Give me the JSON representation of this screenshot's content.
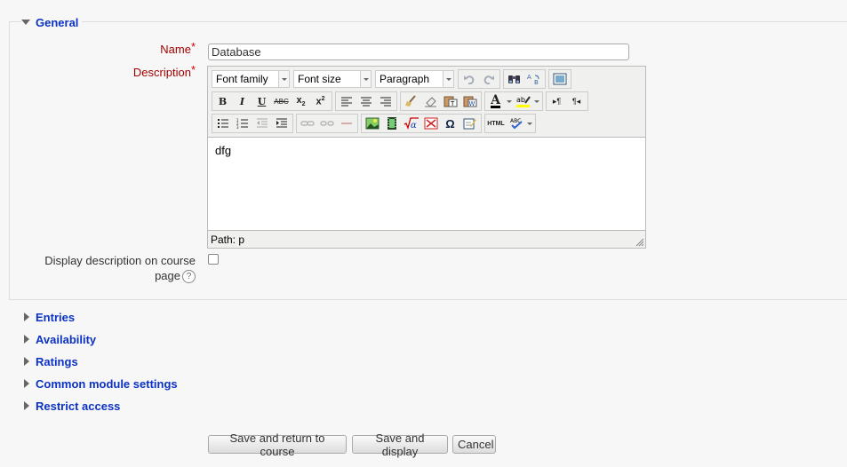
{
  "general": {
    "legend": "General"
  },
  "name": {
    "label": "Name",
    "required_mark": "*",
    "value": "Database"
  },
  "description": {
    "label": "Description",
    "required_mark": "*",
    "toolbar": {
      "font_family": "Font family",
      "font_size": "Font size",
      "paragraph": "Paragraph"
    },
    "content": "dfg",
    "path": "Path: p"
  },
  "display_description": {
    "label_line1": "Display description on course",
    "label_line2": "page",
    "help": "?"
  },
  "sections": [
    "Entries",
    "Availability",
    "Ratings",
    "Common module settings",
    "Restrict access"
  ],
  "buttons": {
    "save_return": "Save and return to course",
    "save_display": "Save and display",
    "cancel": "Cancel"
  },
  "colors": {
    "link": "#0b32c4",
    "required": "#d40000",
    "label_required": "#a10000"
  }
}
